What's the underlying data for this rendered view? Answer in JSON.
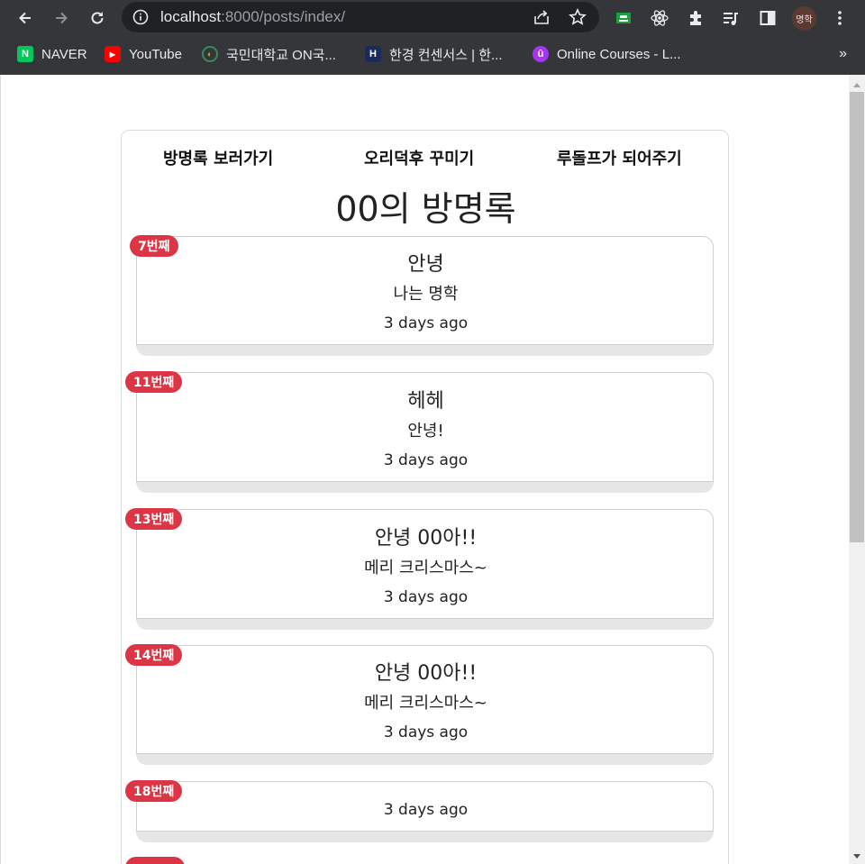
{
  "browser": {
    "url_host": "localhost",
    "url_path": ":8000/posts/index/",
    "profile_label": "명학",
    "bookmarks": [
      {
        "label": "NAVER",
        "icon": "naver-icon",
        "color": "#03c75a",
        "glyph": "N"
      },
      {
        "label": "YouTube",
        "icon": "youtube-icon",
        "color": "#ff0000",
        "glyph": "▶"
      },
      {
        "label": "국민대학교 ON국...",
        "icon": "kookmin-icon",
        "color": "#2b2b2b",
        "glyph": "◐"
      },
      {
        "label": "한경 컨센서스 | 한...",
        "icon": "hankyung-icon",
        "color": "#1a2a5a",
        "glyph": "H"
      },
      {
        "label": "Online Courses - L...",
        "icon": "udemy-icon",
        "color": "#a435f0",
        "glyph": "û"
      }
    ],
    "more": "»"
  },
  "nav": {
    "link1": "방명록 보러가기",
    "link2": "오리덕후 꾸미기",
    "link3": "루돌프가 되어주기"
  },
  "page": {
    "title": "00의 방명록"
  },
  "posts": [
    {
      "badge": "7번째",
      "title": "안녕",
      "body": "나는 명학",
      "time": "3 days ago"
    },
    {
      "badge": "11번째",
      "title": "헤헤",
      "body": "안녕!",
      "time": "3 days ago"
    },
    {
      "badge": "13번째",
      "title": "안녕 00아!!",
      "body": "메리 크리스마스~",
      "time": "3 days ago"
    },
    {
      "badge": "14번째",
      "title": "안녕 00아!!",
      "body": "메리 크리스마스~",
      "time": "3 days ago"
    },
    {
      "badge": "18번째",
      "title": "",
      "body": "",
      "time": "3 days ago"
    }
  ],
  "colors": {
    "badge": "#dc3545",
    "chrome": "#35363a",
    "omnibox": "#202124"
  }
}
